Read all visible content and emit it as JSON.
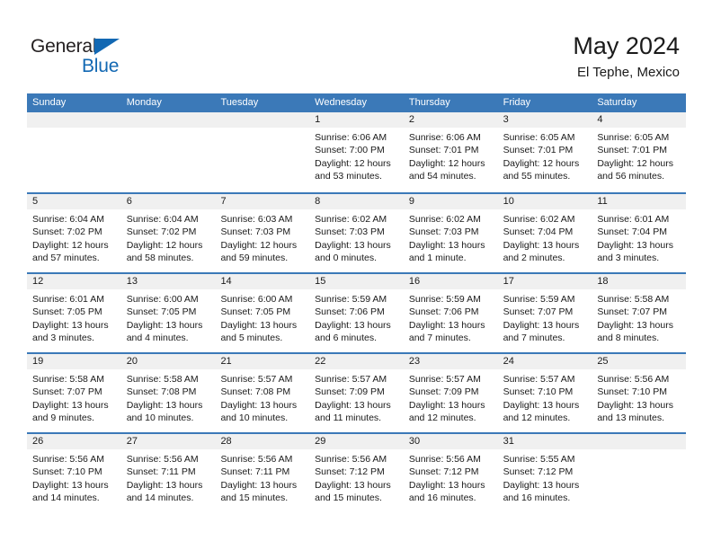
{
  "brand": {
    "name_part1": "General",
    "name_part2": "Blue",
    "triangle_icon": "blue-triangle-icon",
    "colors": {
      "text": "#231f20",
      "accent": "#1268b3"
    }
  },
  "header": {
    "month_title": "May 2024",
    "location": "El Tephe, Mexico"
  },
  "theme": {
    "header_blue": "#3b79b8",
    "day_number_bg": "#f0f0f0",
    "cell_bg": "#ffffff",
    "text": "#1a1a1a"
  },
  "calendar": {
    "weekdays": [
      "Sunday",
      "Monday",
      "Tuesday",
      "Wednesday",
      "Thursday",
      "Friday",
      "Saturday"
    ],
    "weeks": [
      [
        {
          "day": "",
          "lines": []
        },
        {
          "day": "",
          "lines": []
        },
        {
          "day": "",
          "lines": []
        },
        {
          "day": "1",
          "lines": [
            "Sunrise: 6:06 AM",
            "Sunset: 7:00 PM",
            "Daylight: 12 hours",
            "and 53 minutes."
          ]
        },
        {
          "day": "2",
          "lines": [
            "Sunrise: 6:06 AM",
            "Sunset: 7:01 PM",
            "Daylight: 12 hours",
            "and 54 minutes."
          ]
        },
        {
          "day": "3",
          "lines": [
            "Sunrise: 6:05 AM",
            "Sunset: 7:01 PM",
            "Daylight: 12 hours",
            "and 55 minutes."
          ]
        },
        {
          "day": "4",
          "lines": [
            "Sunrise: 6:05 AM",
            "Sunset: 7:01 PM",
            "Daylight: 12 hours",
            "and 56 minutes."
          ]
        }
      ],
      [
        {
          "day": "5",
          "lines": [
            "Sunrise: 6:04 AM",
            "Sunset: 7:02 PM",
            "Daylight: 12 hours",
            "and 57 minutes."
          ]
        },
        {
          "day": "6",
          "lines": [
            "Sunrise: 6:04 AM",
            "Sunset: 7:02 PM",
            "Daylight: 12 hours",
            "and 58 minutes."
          ]
        },
        {
          "day": "7",
          "lines": [
            "Sunrise: 6:03 AM",
            "Sunset: 7:03 PM",
            "Daylight: 12 hours",
            "and 59 minutes."
          ]
        },
        {
          "day": "8",
          "lines": [
            "Sunrise: 6:02 AM",
            "Sunset: 7:03 PM",
            "Daylight: 13 hours",
            "and 0 minutes."
          ]
        },
        {
          "day": "9",
          "lines": [
            "Sunrise: 6:02 AM",
            "Sunset: 7:03 PM",
            "Daylight: 13 hours",
            "and 1 minute."
          ]
        },
        {
          "day": "10",
          "lines": [
            "Sunrise: 6:02 AM",
            "Sunset: 7:04 PM",
            "Daylight: 13 hours",
            "and 2 minutes."
          ]
        },
        {
          "day": "11",
          "lines": [
            "Sunrise: 6:01 AM",
            "Sunset: 7:04 PM",
            "Daylight: 13 hours",
            "and 3 minutes."
          ]
        }
      ],
      [
        {
          "day": "12",
          "lines": [
            "Sunrise: 6:01 AM",
            "Sunset: 7:05 PM",
            "Daylight: 13 hours",
            "and 3 minutes."
          ]
        },
        {
          "day": "13",
          "lines": [
            "Sunrise: 6:00 AM",
            "Sunset: 7:05 PM",
            "Daylight: 13 hours",
            "and 4 minutes."
          ]
        },
        {
          "day": "14",
          "lines": [
            "Sunrise: 6:00 AM",
            "Sunset: 7:05 PM",
            "Daylight: 13 hours",
            "and 5 minutes."
          ]
        },
        {
          "day": "15",
          "lines": [
            "Sunrise: 5:59 AM",
            "Sunset: 7:06 PM",
            "Daylight: 13 hours",
            "and 6 minutes."
          ]
        },
        {
          "day": "16",
          "lines": [
            "Sunrise: 5:59 AM",
            "Sunset: 7:06 PM",
            "Daylight: 13 hours",
            "and 7 minutes."
          ]
        },
        {
          "day": "17",
          "lines": [
            "Sunrise: 5:59 AM",
            "Sunset: 7:07 PM",
            "Daylight: 13 hours",
            "and 7 minutes."
          ]
        },
        {
          "day": "18",
          "lines": [
            "Sunrise: 5:58 AM",
            "Sunset: 7:07 PM",
            "Daylight: 13 hours",
            "and 8 minutes."
          ]
        }
      ],
      [
        {
          "day": "19",
          "lines": [
            "Sunrise: 5:58 AM",
            "Sunset: 7:07 PM",
            "Daylight: 13 hours",
            "and 9 minutes."
          ]
        },
        {
          "day": "20",
          "lines": [
            "Sunrise: 5:58 AM",
            "Sunset: 7:08 PM",
            "Daylight: 13 hours",
            "and 10 minutes."
          ]
        },
        {
          "day": "21",
          "lines": [
            "Sunrise: 5:57 AM",
            "Sunset: 7:08 PM",
            "Daylight: 13 hours",
            "and 10 minutes."
          ]
        },
        {
          "day": "22",
          "lines": [
            "Sunrise: 5:57 AM",
            "Sunset: 7:09 PM",
            "Daylight: 13 hours",
            "and 11 minutes."
          ]
        },
        {
          "day": "23",
          "lines": [
            "Sunrise: 5:57 AM",
            "Sunset: 7:09 PM",
            "Daylight: 13 hours",
            "and 12 minutes."
          ]
        },
        {
          "day": "24",
          "lines": [
            "Sunrise: 5:57 AM",
            "Sunset: 7:10 PM",
            "Daylight: 13 hours",
            "and 12 minutes."
          ]
        },
        {
          "day": "25",
          "lines": [
            "Sunrise: 5:56 AM",
            "Sunset: 7:10 PM",
            "Daylight: 13 hours",
            "and 13 minutes."
          ]
        }
      ],
      [
        {
          "day": "26",
          "lines": [
            "Sunrise: 5:56 AM",
            "Sunset: 7:10 PM",
            "Daylight: 13 hours",
            "and 14 minutes."
          ]
        },
        {
          "day": "27",
          "lines": [
            "Sunrise: 5:56 AM",
            "Sunset: 7:11 PM",
            "Daylight: 13 hours",
            "and 14 minutes."
          ]
        },
        {
          "day": "28",
          "lines": [
            "Sunrise: 5:56 AM",
            "Sunset: 7:11 PM",
            "Daylight: 13 hours",
            "and 15 minutes."
          ]
        },
        {
          "day": "29",
          "lines": [
            "Sunrise: 5:56 AM",
            "Sunset: 7:12 PM",
            "Daylight: 13 hours",
            "and 15 minutes."
          ]
        },
        {
          "day": "30",
          "lines": [
            "Sunrise: 5:56 AM",
            "Sunset: 7:12 PM",
            "Daylight: 13 hours",
            "and 16 minutes."
          ]
        },
        {
          "day": "31",
          "lines": [
            "Sunrise: 5:55 AM",
            "Sunset: 7:12 PM",
            "Daylight: 13 hours",
            "and 16 minutes."
          ]
        },
        {
          "day": "",
          "lines": []
        }
      ]
    ]
  }
}
